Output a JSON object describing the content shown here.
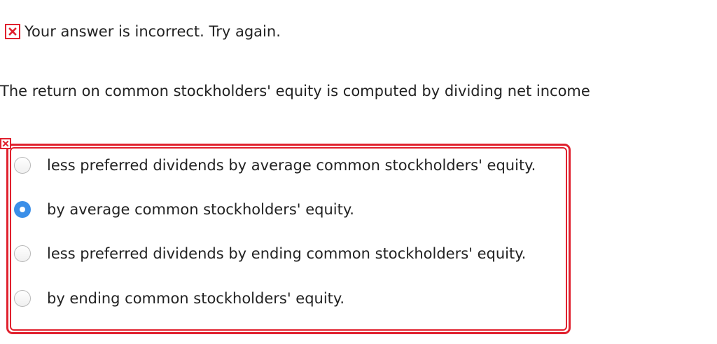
{
  "feedback": {
    "icon": "incorrect-x-icon",
    "text": "Your answer is incorrect.  Try again.",
    "color": "#e0212e"
  },
  "question": {
    "text": "The return on common stockholders' equity is computed by dividing net income"
  },
  "choices": [
    {
      "label": "less preferred dividends by average common stockholders' equity.",
      "selected": false
    },
    {
      "label": "by average common stockholders' equity.",
      "selected": true
    },
    {
      "label": "less preferred dividends by ending common stockholders' equity.",
      "selected": false
    },
    {
      "label": "by ending common stockholders' equity.",
      "selected": false
    }
  ],
  "colors": {
    "error": "#e0212e",
    "radio_selected": "#3b8fe8",
    "text": "#222222"
  }
}
